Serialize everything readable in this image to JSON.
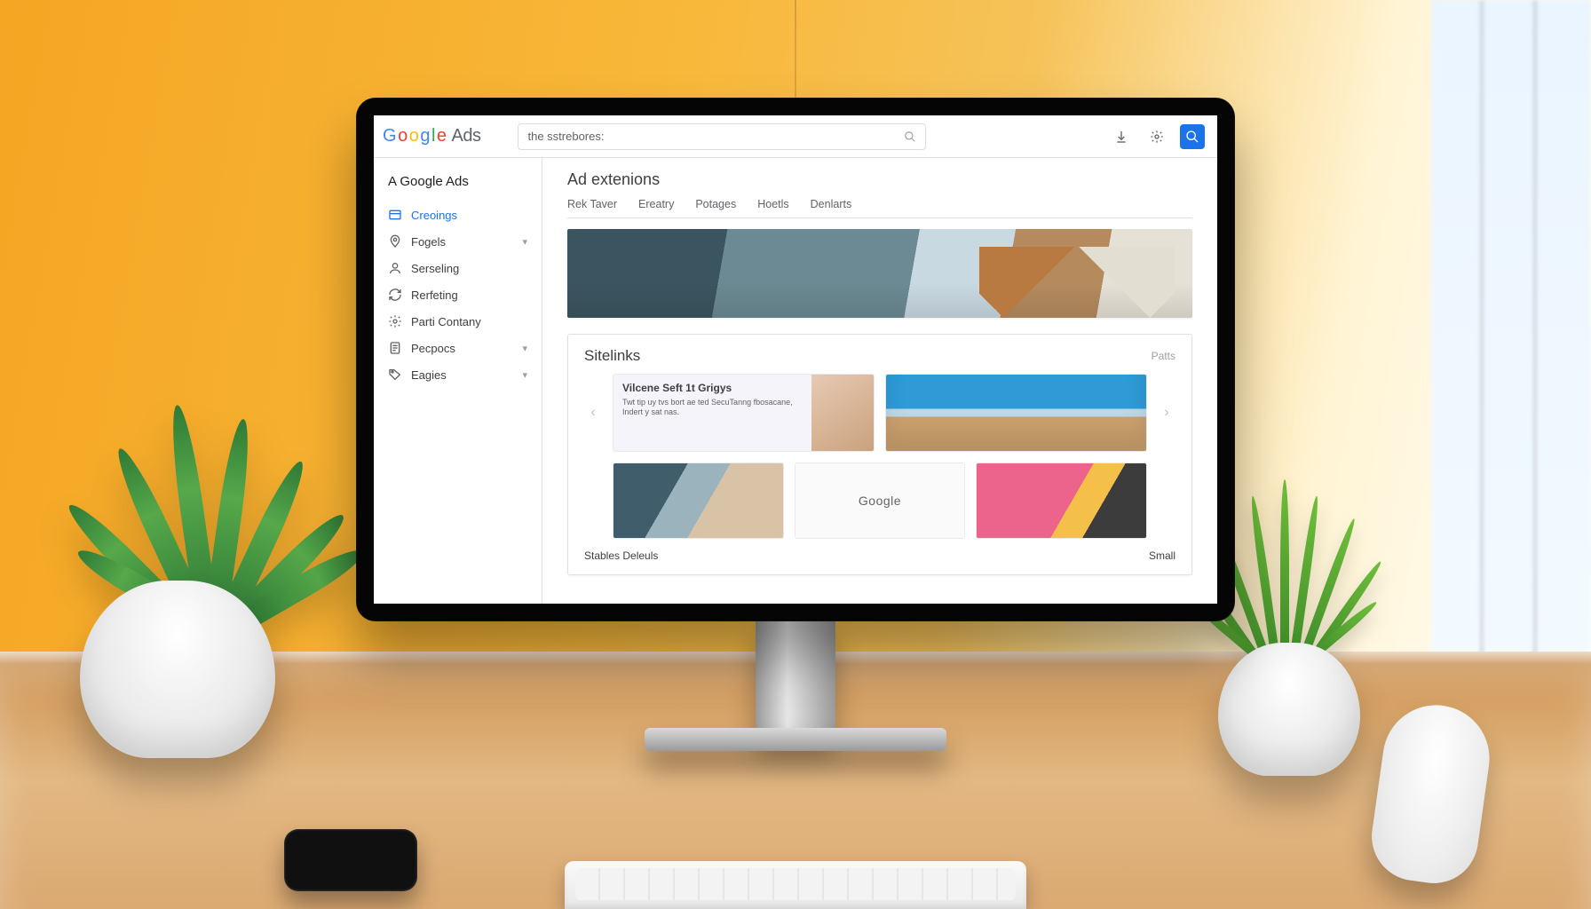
{
  "colors": {
    "accent": "#1a73e8",
    "text": "#3c4043",
    "muted": "#5f6368",
    "border": "#e0e0e0"
  },
  "header": {
    "product_suffix": "Ads",
    "search_value": "the sstrebores:"
  },
  "sidebar": {
    "title": "A Google Ads",
    "items": [
      {
        "label": "Creoings",
        "icon": "card-icon",
        "active": true
      },
      {
        "label": "Fogels",
        "icon": "pin-icon",
        "expandable": true
      },
      {
        "label": "Serseling",
        "icon": "person-icon"
      },
      {
        "label": "Rerfeting",
        "icon": "refresh-icon"
      },
      {
        "label": "Parti Contany",
        "icon": "gear-icon"
      },
      {
        "label": "Pecpocs",
        "icon": "doc-icon",
        "expandable": true
      },
      {
        "label": "Eagies",
        "icon": "tag-icon",
        "expandable": true
      }
    ]
  },
  "main": {
    "page_title": "Ad extenions",
    "tabs": [
      "Rek Taver",
      "Ereatry",
      "Potages",
      "Hoetls",
      "Denlarts"
    ],
    "panel": {
      "title": "Sitelinks",
      "meta": "Patts",
      "feature": {
        "heading": "Vilcene Seft 1t Grigys",
        "body": "Twt tip uy tvs bort ae ted SecuTanng fbosacane, Indert y sat nas."
      },
      "note_card_label": "Google",
      "footer_left": "Stables Deleuls",
      "footer_right": "Small"
    }
  }
}
